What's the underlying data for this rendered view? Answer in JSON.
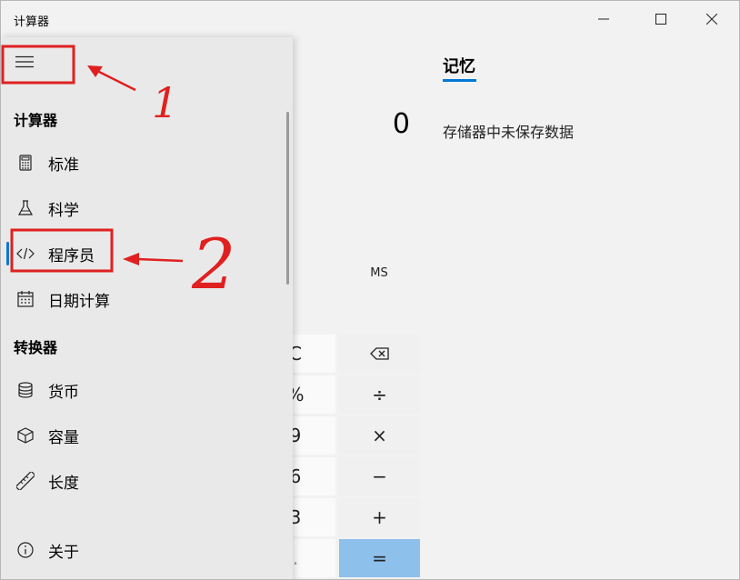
{
  "window": {
    "title": "计算器",
    "minimize_glyph": "—",
    "maximize_glyph": "☐",
    "close_glyph": "✕"
  },
  "nav": {
    "menu_icon": "hamburger-icon",
    "sections": [
      {
        "title": "计算器",
        "items": [
          {
            "label": "标准",
            "icon": "calculator-icon"
          },
          {
            "label": "科学",
            "icon": "flask-icon"
          },
          {
            "label": "程序员",
            "icon": "code-icon",
            "selected": true
          },
          {
            "label": "日期计算",
            "icon": "calendar-icon"
          }
        ]
      },
      {
        "title": "转换器",
        "items": [
          {
            "label": "货币",
            "icon": "coins-icon"
          },
          {
            "label": "容量",
            "icon": "cube-icon"
          },
          {
            "label": "长度",
            "icon": "ruler-icon"
          }
        ]
      }
    ],
    "about": {
      "label": "关于",
      "icon": "info-icon"
    }
  },
  "memory": {
    "tab_label": "记忆",
    "empty_message": "存储器中未保存数据"
  },
  "display": {
    "value": "0"
  },
  "memory_buttons": {
    "ms": "MS"
  },
  "keypad": {
    "rows": [
      [
        "C",
        "⌫"
      ],
      [
        "%",
        "÷"
      ],
      [
        "9",
        "×"
      ],
      [
        "6",
        "−"
      ],
      [
        "3",
        "+"
      ],
      [
        ".",
        "="
      ]
    ]
  },
  "annotations": {
    "step1": "1",
    "step2": "2",
    "color": "#e02020"
  },
  "colors": {
    "accent": "#0078d4",
    "equals_key": "#8ec0ec"
  }
}
